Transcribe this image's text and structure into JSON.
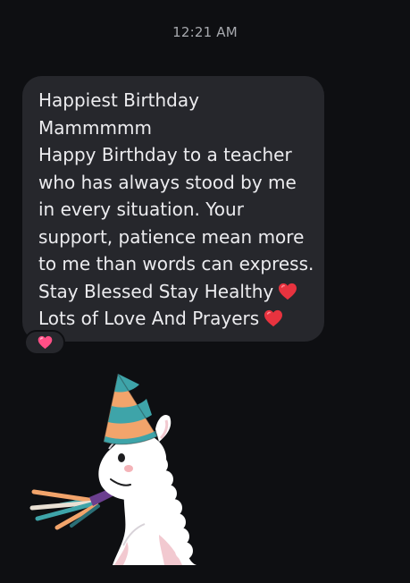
{
  "conversation": {
    "timestamp": "12:21 AM",
    "message": {
      "lines": [
        "Happiest Birthday",
        "Mammmmm",
        "Happy Birthday to a teacher",
        "who has always stood by me",
        "in every situation. Your",
        "support, patience  mean more",
        "to me than words can express.",
        "Stay Blessed Stay Healthy",
        "Lots of Love And Prayers"
      ],
      "inline_emoji": "red-heart-icon",
      "reaction_emoji": "pink-heart-icon"
    },
    "sticker": {
      "icon": "party-llama-sticker-icon"
    }
  },
  "colors": {
    "background": "#0e0f12",
    "bubble": "#26272c",
    "text": "#ececef",
    "timestamp": "#a7a9ae",
    "heart_red": "#e8333f",
    "heart_pink": "#ff4f86"
  }
}
